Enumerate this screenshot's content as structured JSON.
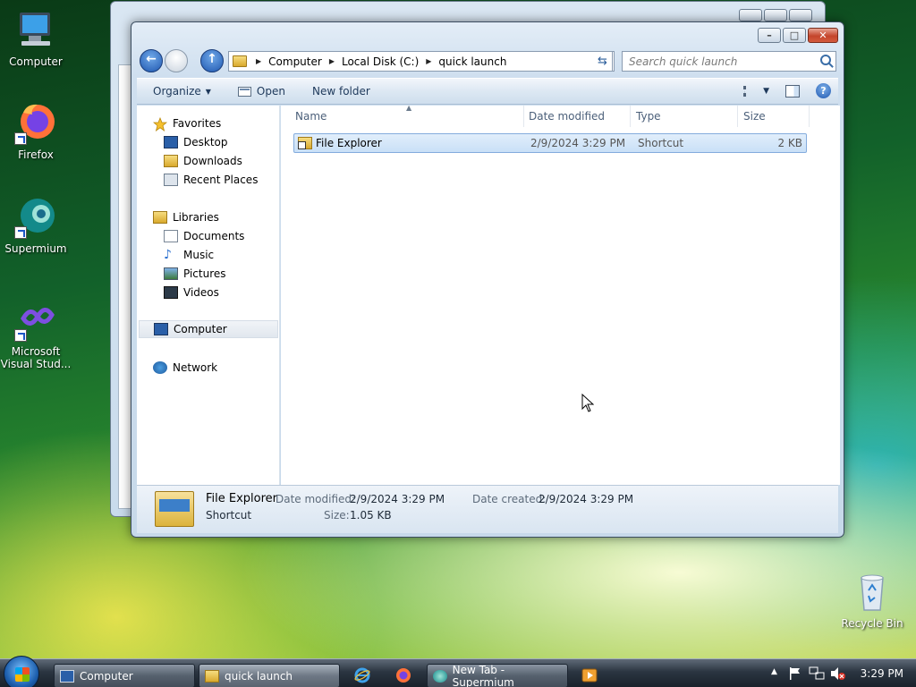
{
  "desktop": {
    "icons": [
      {
        "label": "Computer"
      },
      {
        "label": "Firefox"
      },
      {
        "label": "Supermium"
      },
      {
        "label": "Microsoft Visual Stud..."
      },
      {
        "label": "Recycle Bin"
      }
    ]
  },
  "explorer": {
    "breadcrumb": [
      "Computer",
      "Local Disk (C:)",
      "quick launch"
    ],
    "search_placeholder": "Search quick launch",
    "toolbar": {
      "organize_label": "Organize",
      "open_label": "Open",
      "new_folder_label": "New folder"
    },
    "nav": {
      "favorites_label": "Favorites",
      "favorites": [
        "Desktop",
        "Downloads",
        "Recent Places"
      ],
      "libraries_label": "Libraries",
      "libraries": [
        "Documents",
        "Music",
        "Pictures",
        "Videos"
      ],
      "computer_label": "Computer",
      "network_label": "Network"
    },
    "columns": [
      "Name",
      "Date modified",
      "Type",
      "Size"
    ],
    "files": [
      {
        "name": "File Explorer",
        "date_modified": "2/9/2024 3:29 PM",
        "type": "Shortcut",
        "size": "2 KB"
      }
    ],
    "details": {
      "name": "File Explorer",
      "type": "Shortcut",
      "date_modified_label": "Date modified:",
      "date_modified": "2/9/2024 3:29 PM",
      "date_created_label": "Date created:",
      "date_created": "2/9/2024 3:29 PM",
      "size_label": "Size:",
      "size": "1.05 KB"
    }
  },
  "taskbar": {
    "buttons": [
      "Computer",
      "quick launch",
      "New Tab - Supermium"
    ],
    "clock": "3:29 PM"
  },
  "colors": {
    "accent": "#1f57b0",
    "selection": "#c9e0f7",
    "close": "#c4452c"
  }
}
